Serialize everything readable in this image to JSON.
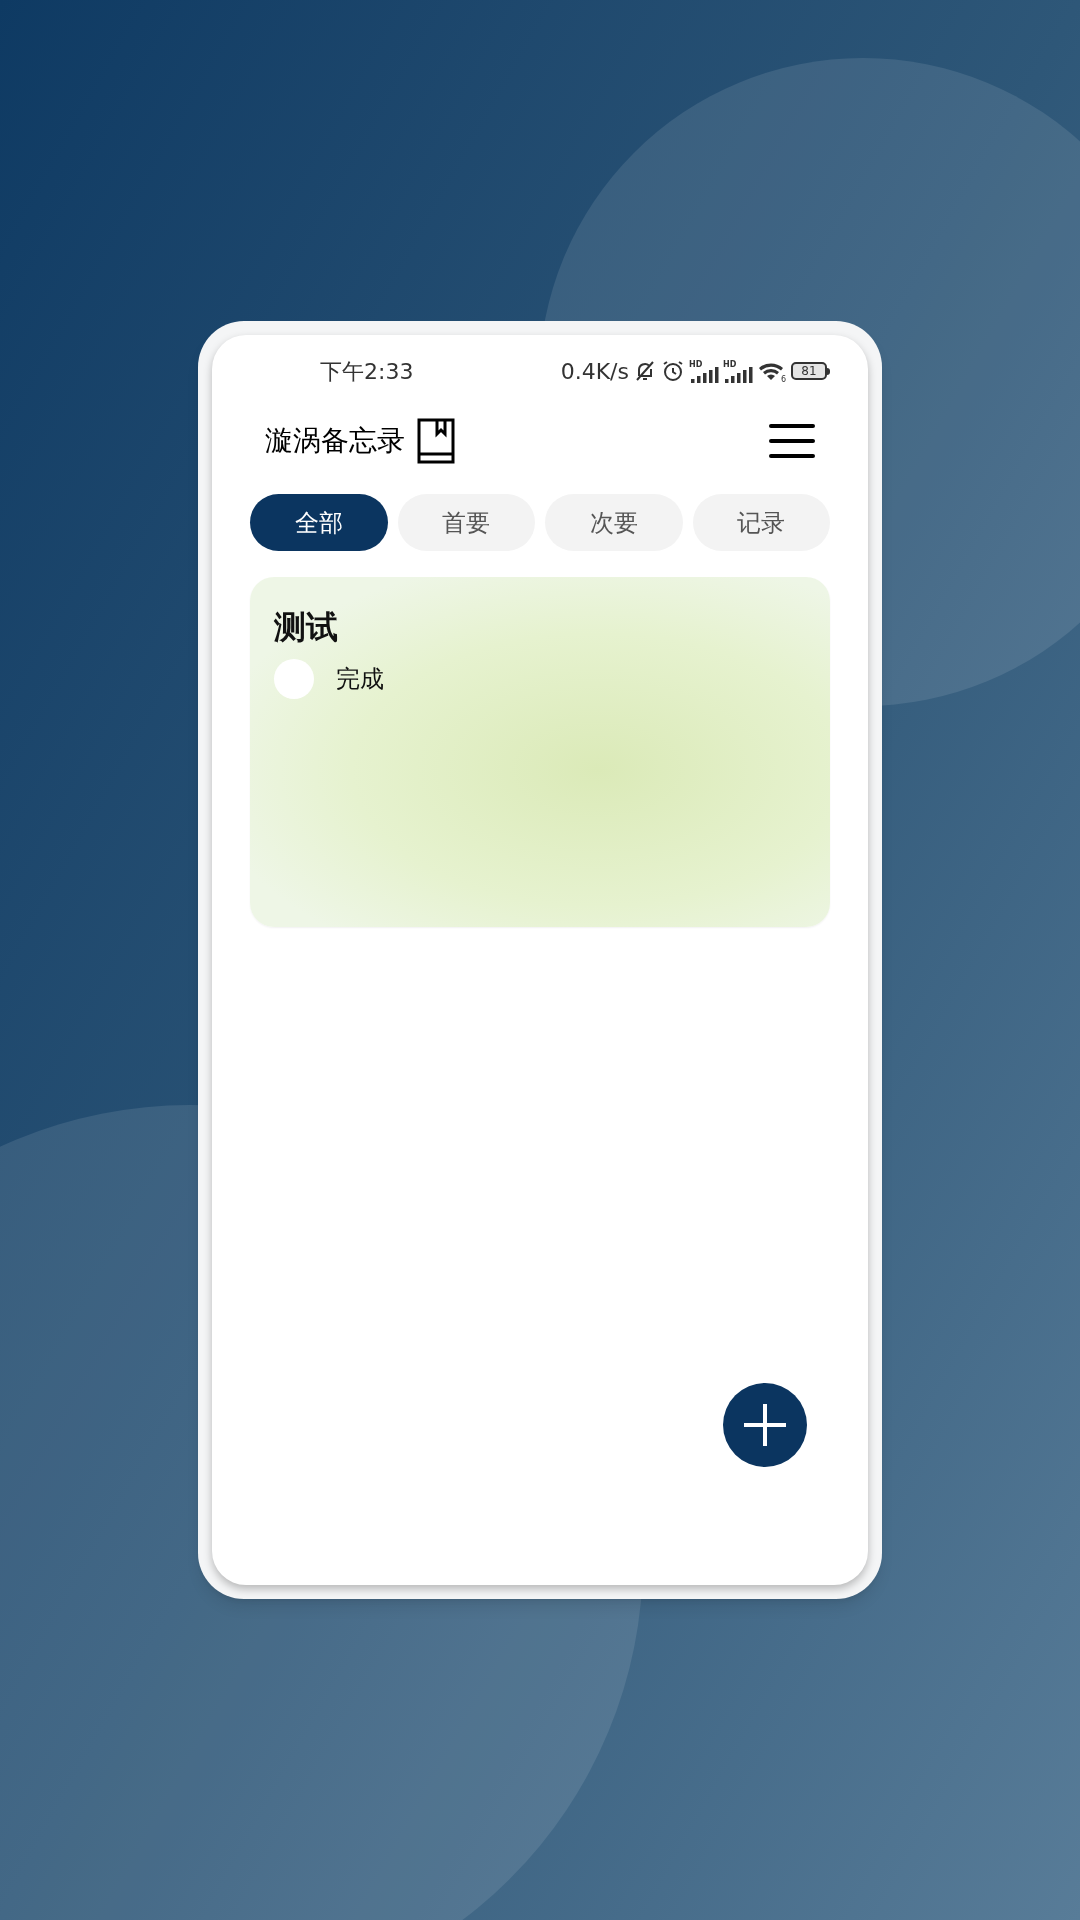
{
  "status_bar": {
    "time": "下午2:33",
    "net_speed": "0.4K/s",
    "sim_labels": [
      "HD",
      "HD"
    ],
    "wifi_label": "6",
    "battery": "81"
  },
  "app_bar": {
    "title": "漩涡备忘录"
  },
  "tabs": [
    {
      "label": "全部",
      "selected": true
    },
    {
      "label": "首要",
      "selected": false
    },
    {
      "label": "次要",
      "selected": false
    },
    {
      "label": "记录",
      "selected": false
    }
  ],
  "notes": [
    {
      "title": "测试",
      "items": [
        {
          "text": "完成",
          "checked": false
        }
      ]
    }
  ]
}
